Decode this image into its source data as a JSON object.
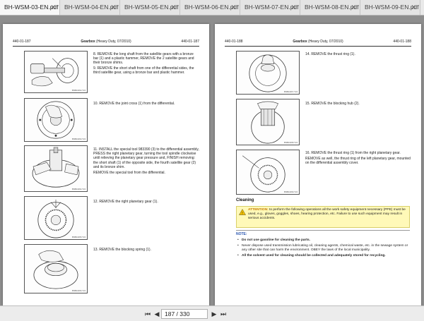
{
  "tabs": [
    {
      "label": "BH-WSM-03-EN.pdf",
      "active": true
    },
    {
      "label": "BH-WSM-04-EN.pdf"
    },
    {
      "label": "BH-WSM-05-EN.pdf"
    },
    {
      "label": "BH-WSM-06-EN.pdf"
    },
    {
      "label": "BH-WSM-07-EN.pdf"
    },
    {
      "label": "BH-WSM-08-EN.pdf"
    },
    {
      "label": "BH-WSM-09-EN.pdf"
    }
  ],
  "left_page": {
    "header_left": "440-01-187",
    "header_title": "Gearbox",
    "header_sub": "(Heavy Duty, 07/2010)",
    "header_right": "440-01-187",
    "steps": [
      {
        "n": "8.",
        "text": "REMOVE the long shaft from the satellite gears with a bronze bar (1) and a plastic hammer, REMOVE the 2 satellite gears and their bronze shims.",
        "extra": "9. REMOVE the short shaft from one of the differential sides, the third satellite gear, using a bronze bar and plastic hammer.",
        "code": "BSB04462-T24"
      },
      {
        "n": "10.",
        "text": "REMOVE the joint cross (1) from the differential.",
        "code": "BSB04463-T24"
      },
      {
        "n": "11.",
        "text": "INSTALL the special tool 983390 (3) to the differential assembly, PRESS the right planetary gear, turning the tool spindle clockwise until relieving the planetary gear pressure and, FINISH removing: the short shaft (1) of the opposite side, the fourth satellite gear (2) and its bronze shim.",
        "extra": "REMOVE the special tool from the differential.",
        "code": "BSB04464-T24"
      },
      {
        "n": "12.",
        "text": "REMOVE the right planetary gear (1).",
        "code": "BSB04465-T24"
      },
      {
        "n": "13.",
        "text": "REMOVE the blocking spring (1).",
        "code": "BSB04466-T24"
      }
    ]
  },
  "right_page": {
    "header_left": "440-01-188",
    "header_title": "Gearbox",
    "header_sub": "(Heavy Duty, 07/2010)",
    "header_right": "440-01-188",
    "steps": [
      {
        "n": "14.",
        "text": "REMOVE the thrust ring (1).",
        "code": "BSB04467-T24"
      },
      {
        "n": "15.",
        "text": "REMOVE the blocking hub (2).",
        "code": "BSB04468-T24"
      },
      {
        "n": "16.",
        "text": "REMOVE the thrust ring (1) from the right planetary gear.",
        "extra": "REMOVE as well, the thrust ring of the left planetary gear, mounted on the differential assembly cover.",
        "code": "BSB04469-T24"
      }
    ],
    "cleaning_title": "Cleaning",
    "attention_label": "ATTENTION:",
    "attention_text": " to perform the following operations all the work safety equipment necessary (PPE) must be used, e.g., gloves, goggles, shoes, hearing protection, etc. Failure to use such equipment may result in serious accidents.",
    "note_label": "NOTE:",
    "note_items": [
      "Do not use gasoline for cleaning the parts.",
      "Never dispose used transmission lubricating oil, cleaning agents, chemical waste, etc. in the sewage system or any other site that can harm the environment. OBEY the laws of the local municipality.",
      "All the solvent used for cleaning should be collected and adequately stored for recycling."
    ]
  },
  "toolbar": {
    "page_indicator": "187 / 330"
  }
}
